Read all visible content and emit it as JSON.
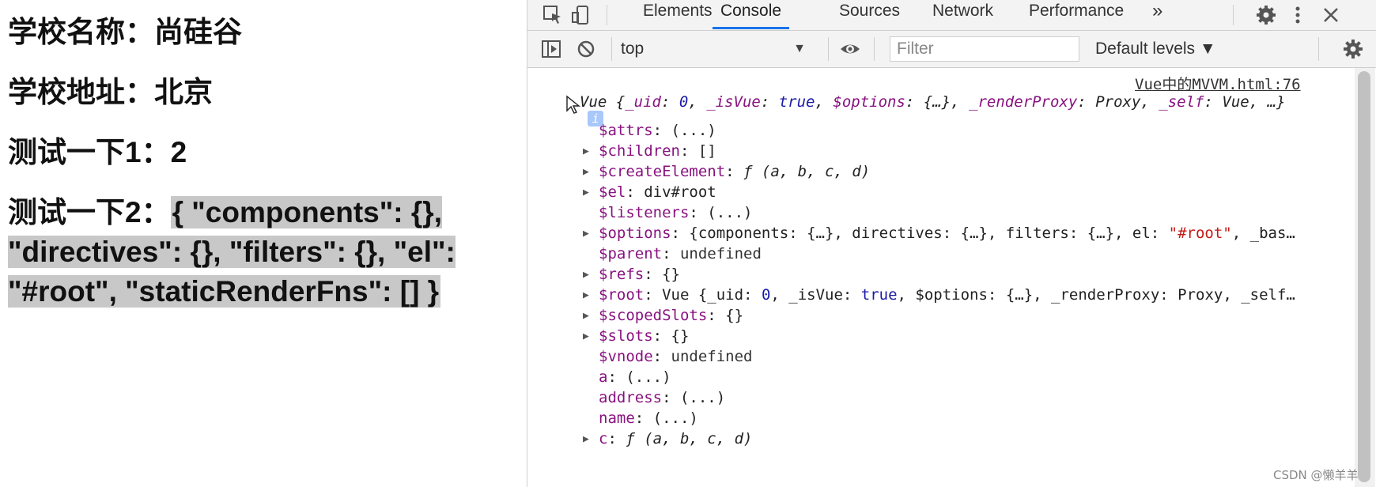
{
  "page": {
    "school_name_line": "学校名称：尚硅谷",
    "school_address_line": "学校地址：北京",
    "test1_line": "测试一下1：2",
    "test2_prefix": "测试一下2：",
    "test2_value": "{ \"components\": {}, \"directives\": {}, \"filters\": {}, \"el\": \"#root\", \"staticRenderFns\": [] }"
  },
  "devtools": {
    "tabs": [
      "Elements",
      "Console",
      "Sources",
      "Network",
      "Performance"
    ],
    "active_tab": "Console",
    "more_tabs": "»",
    "context": "top",
    "filter_placeholder": "Filter",
    "levels": "Default levels ▼",
    "source_link": "Vue中的MVVM.html:76",
    "header": {
      "prefix": "Vue {",
      "uid_key": "_uid",
      "uid_val": "0",
      "isvue_key": "_isVue",
      "isvue_val": "true",
      "options_key": "$options",
      "options_val": "{…}",
      "proxy_key": "_renderProxy",
      "proxy_val": "Proxy",
      "self_key": "_self",
      "self_val": "Vue, …}"
    },
    "info_badge": "i",
    "props": {
      "attrs": {
        "key": "$attrs",
        "val": "(...)"
      },
      "children": {
        "key": "$children",
        "val": "[]"
      },
      "createElement": {
        "key": "$createElement",
        "val": "ƒ (a, b, c, d)"
      },
      "el": {
        "key": "$el",
        "val": "div#root"
      },
      "listeners": {
        "key": "$listeners",
        "val": "(...)"
      },
      "options": {
        "key": "$options",
        "val_pre": "{components: {…}, directives: {…}, filters: {…}, el: ",
        "val_str": "\"#root\"",
        "val_post": ", _bas…"
      },
      "parent": {
        "key": "$parent",
        "val": "undefined"
      },
      "refs": {
        "key": "$refs",
        "val": "{}"
      },
      "root": {
        "key": "$root",
        "val_pre": "Vue {_uid: ",
        "uid": "0",
        "mid1": ", _isVue: ",
        "isvue": "true",
        "mid2": ", $options: {…}, _renderProxy: Proxy, _self…"
      },
      "scopedSlots": {
        "key": "$scopedSlots",
        "val": "{}"
      },
      "slots": {
        "key": "$slots",
        "val": "{}"
      },
      "vnode": {
        "key": "$vnode",
        "val": "undefined"
      },
      "a": {
        "key": "a",
        "val": "(...)"
      },
      "address": {
        "key": "address",
        "val": "(...)"
      },
      "name": {
        "key": "name",
        "val": "(...)"
      },
      "c": {
        "key": "c",
        "val": "ƒ (a, b, c, d)"
      }
    }
  },
  "watermark": "CSDN @懒羊羊"
}
